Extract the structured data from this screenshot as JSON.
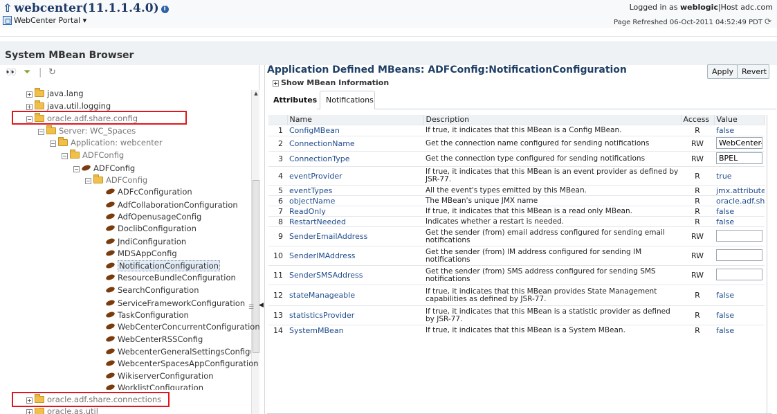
{
  "header": {
    "app_title": "webcenter(11.1.1.4.0)",
    "portal_menu": "WebCenter Portal",
    "logged_in_prefix": "Logged in as",
    "user": "weblogic",
    "host_sep": "|Host",
    "host": "adc.com",
    "refreshed": "Page Refreshed 06-Oct-2011 04:52:49 PDT"
  },
  "page": {
    "title": "System MBean Browser"
  },
  "tree": {
    "nodes": [
      {
        "label": "java.lang"
      },
      {
        "label": "java.util.logging"
      },
      {
        "label": "oracle.adf.share.config"
      },
      {
        "label": "Server: WC_Spaces"
      },
      {
        "label": "Application: webcenter"
      },
      {
        "label": "ADFConfig"
      },
      {
        "label": "ADFConfig"
      },
      {
        "label": "ADFConfig"
      },
      {
        "label": "ADFcConfiguration"
      },
      {
        "label": "AdfCollaborationConfiguration"
      },
      {
        "label": "AdfOpenusageConfig"
      },
      {
        "label": "DoclibConfiguration"
      },
      {
        "label": "JndiConfiguration"
      },
      {
        "label": "MDSAppConfig"
      },
      {
        "label": "NotificationConfiguration"
      },
      {
        "label": "ResourceBundleConfiguration"
      },
      {
        "label": "SearchConfiguration"
      },
      {
        "label": "ServiceFrameworkConfiguration"
      },
      {
        "label": "TaskConfiguration"
      },
      {
        "label": "WebCenterConcurrentConfiguration"
      },
      {
        "label": "WebCenterRSSConfig"
      },
      {
        "label": "WebcenterGeneralSettingsConfigura"
      },
      {
        "label": "WebcenterSpacesAppConfiguration"
      },
      {
        "label": "WikiserverConfiguration"
      },
      {
        "label": "WorklistConfiguration"
      },
      {
        "label": "oracle.adf.share.connections"
      },
      {
        "label": "oracle.as.util"
      }
    ]
  },
  "content": {
    "title": "Application Defined MBeans: ADFConfig:NotificationConfiguration",
    "show_info": "Show MBean Information",
    "apply": "Apply",
    "revert": "Revert",
    "tabs": [
      "Attributes",
      "Notifications"
    ],
    "columns": {
      "name": "Name",
      "description": "Description",
      "access": "Access",
      "value": "Value"
    },
    "rows": [
      {
        "n": "1",
        "name": "ConfigMBean",
        "desc": "If true, it indicates that this MBean is a Config MBean.",
        "access": "R",
        "value": "false"
      },
      {
        "n": "2",
        "name": "ConnectionName",
        "desc": "Get the connection name configured for sending notifications",
        "access": "RW",
        "value": "WebCenter-V"
      },
      {
        "n": "3",
        "name": "ConnectionType",
        "desc": "Get the connection type configured for sending notifications",
        "access": "RW",
        "value": "BPEL"
      },
      {
        "n": "4",
        "name": "eventProvider",
        "desc": "If true, it indicates that this MBean is an event provider as defined by JSR-77.",
        "access": "R",
        "value": "true"
      },
      {
        "n": "5",
        "name": "eventTypes",
        "desc": "All the event's types emitted by this MBean.",
        "access": "R",
        "value": "jmx.attribute.c"
      },
      {
        "n": "6",
        "name": "objectName",
        "desc": "The MBean's unique JMX name",
        "access": "R",
        "value": "oracle.adf.sha"
      },
      {
        "n": "7",
        "name": "ReadOnly",
        "desc": "If true, it indicates that this MBean is a read only MBean.",
        "access": "R",
        "value": "false"
      },
      {
        "n": "8",
        "name": "RestartNeeded",
        "desc": "Indicates whether a restart is needed.",
        "access": "R",
        "value": "false"
      },
      {
        "n": "9",
        "name": "SenderEmailAddress",
        "desc": "Get the sender (from) email address configured for sending email notifications",
        "access": "RW",
        "value": ""
      },
      {
        "n": "10",
        "name": "SenderIMAddress",
        "desc": "Get the sender (from) IM address configured for sending IM notifications",
        "access": "RW",
        "value": ""
      },
      {
        "n": "11",
        "name": "SenderSMSAddress",
        "desc": "Get the sender (from) SMS address configured for sending SMS notifications",
        "access": "RW",
        "value": ""
      },
      {
        "n": "12",
        "name": "stateManageable",
        "desc": "If true, it indicates that this MBean provides State Management capabilities as defined by JSR-77.",
        "access": "R",
        "value": "false"
      },
      {
        "n": "13",
        "name": "statisticsProvider",
        "desc": "If true, it indicates that this MBean is a statistic provider as defined by JSR-77.",
        "access": "R",
        "value": "false"
      },
      {
        "n": "14",
        "name": "SystemMBean",
        "desc": "If true, it indicates that this MBean is a System MBean.",
        "access": "R",
        "value": "false"
      }
    ]
  }
}
